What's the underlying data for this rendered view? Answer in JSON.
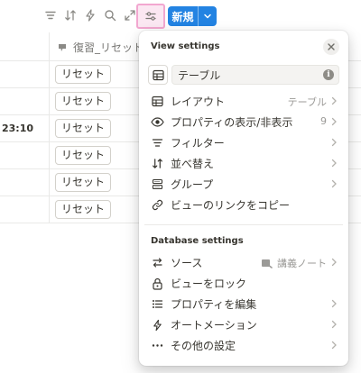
{
  "toolbar": {
    "icons": [
      "filter-icon",
      "sort-icon",
      "automation-icon",
      "search-icon",
      "expand-icon",
      "settings-icon"
    ],
    "new_label": "新規"
  },
  "table": {
    "column_title": "復習_リセット",
    "rows": [
      {
        "time": "",
        "button": "リセット"
      },
      {
        "time": "",
        "button": "リセット"
      },
      {
        "time": "23:10",
        "button": "リセット"
      },
      {
        "time": "",
        "button": "リセット"
      },
      {
        "time": "",
        "button": "リセット"
      },
      {
        "time": "",
        "button": "リセット"
      }
    ]
  },
  "popup": {
    "title": "View settings",
    "view_name": "テーブル",
    "items": [
      {
        "label": "レイアウト",
        "value": "テーブル"
      },
      {
        "label": "プロパティの表示/非表示",
        "value": "9"
      },
      {
        "label": "フィルター",
        "value": ""
      },
      {
        "label": "並べ替え",
        "value": ""
      },
      {
        "label": "グループ",
        "value": ""
      },
      {
        "label": "ビューのリンクをコピー",
        "value": ""
      }
    ],
    "db_title": "Database settings",
    "db_items": [
      {
        "label": "ソース",
        "value": "講義ノート"
      },
      {
        "label": "ビューをロック",
        "value": ""
      },
      {
        "label": "プロパティを編集",
        "value": ""
      },
      {
        "label": "オートメーション",
        "value": ""
      },
      {
        "label": "その他の設定",
        "value": ""
      }
    ]
  },
  "colors": {
    "accent": "#2383e2",
    "settings_highlight": "#fbe7f2",
    "settings_border": "#f2a7d0"
  }
}
